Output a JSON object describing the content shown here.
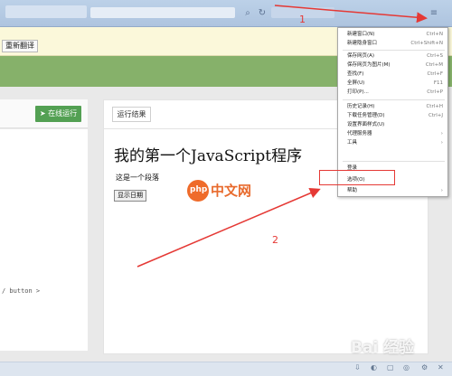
{
  "translate_bar": {
    "button_label": "重新翻译"
  },
  "left_panel": {
    "run_button": "在线运行",
    "code_snippet": "/ button >"
  },
  "right_panel": {
    "result_tab": "运行结果",
    "heading": "我的第一个JavaScript程序",
    "paragraph": "这是一个段落",
    "button_label": "显示日期"
  },
  "context_menu": {
    "items": [
      {
        "label": "新建窗口(N)",
        "shortcut": "Ctrl+N"
      },
      {
        "label": "新建隐身窗口",
        "shortcut": "Ctrl+Shift+N"
      },
      {
        "label": "保存网页(A)",
        "shortcut": "Ctrl+S"
      },
      {
        "label": "保存网页为图片(M)",
        "shortcut": "Ctrl+M"
      },
      {
        "label": "查找(F)",
        "shortcut": "Ctrl+F"
      },
      {
        "label": "全屏(U)",
        "shortcut": "F11"
      },
      {
        "label": "打印(P)...",
        "shortcut": "Ctrl+P"
      },
      {
        "label": "历史记录(H)",
        "shortcut": "Ctrl+H"
      },
      {
        "label": "下载任务管理(D)",
        "shortcut": "Ctrl+J"
      },
      {
        "label": "设置界面样式(U)",
        "shortcut": ""
      },
      {
        "label": "代理服务器",
        "shortcut": ""
      },
      {
        "label": "工具",
        "shortcut": ""
      },
      {
        "label": "登录",
        "shortcut": ""
      },
      {
        "label": "选项(O)",
        "shortcut": ""
      },
      {
        "label": "帮助",
        "shortcut": ""
      }
    ]
  },
  "annotations": {
    "step1": "1",
    "step2": "2"
  },
  "watermarks": {
    "php_logo_text": "php",
    "php_site": "中文网",
    "baidu": "Bai 经验"
  },
  "colors": {
    "annotation": "#e53935",
    "run_button": "#53a053",
    "green_band": "#86b16a"
  }
}
